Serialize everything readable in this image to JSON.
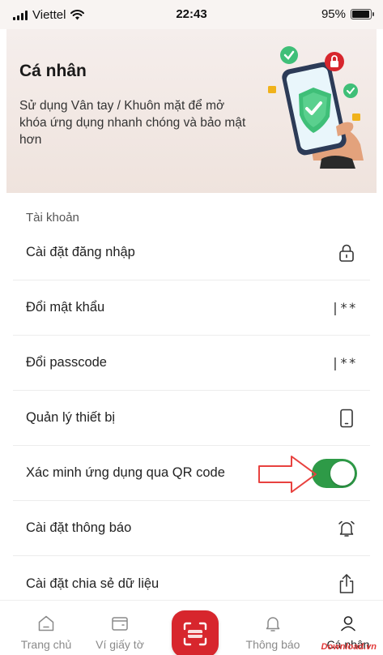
{
  "status_bar": {
    "carrier": "Viettel",
    "time": "22:43",
    "battery": "95%",
    "battery_level": 0.95
  },
  "banner": {
    "title": "Cá nhân",
    "description": "Sử dụng Vân tay / Khuôn mặt để mở khóa ứng dụng nhanh chóng và bảo mật hơn",
    "illustration": "phone-shield-illustration"
  },
  "section": {
    "title": "Tài khoản"
  },
  "settings": [
    {
      "label": "Cài đặt đăng nhập",
      "icon": "lock-icon"
    },
    {
      "label": "Đổi mật khẩu",
      "icon": "password-mask-icon",
      "icon_text": "|**"
    },
    {
      "label": "Đổi passcode",
      "icon": "passcode-mask-icon",
      "icon_text": "|**"
    },
    {
      "label": "Quản lý thiết bị",
      "icon": "device-icon"
    },
    {
      "label": "Xác minh ứng dụng qua QR code",
      "icon": "toggle",
      "toggle_on": true
    },
    {
      "label": "Cài đặt thông báo",
      "icon": "alarm-bell-icon"
    },
    {
      "label": "Cài đặt chia sẻ dữ liệu",
      "icon": "share-icon"
    }
  ],
  "bottom_nav": [
    {
      "label": "Trang chủ",
      "icon": "home-icon"
    },
    {
      "label": "Ví giấy tờ",
      "icon": "wallet-icon"
    },
    {
      "label": "",
      "icon": "scan-icon"
    },
    {
      "label": "Thông báo",
      "icon": "bell-icon"
    },
    {
      "label": "Cá nhân",
      "icon": "user-icon",
      "active": true
    }
  ],
  "watermark": "Download.vn",
  "colors": {
    "accent": "#d7262d",
    "toggle_on": "#2e9a47",
    "annotation_arrow": "#e8423f",
    "banner_bg": "#f3ebe8"
  }
}
